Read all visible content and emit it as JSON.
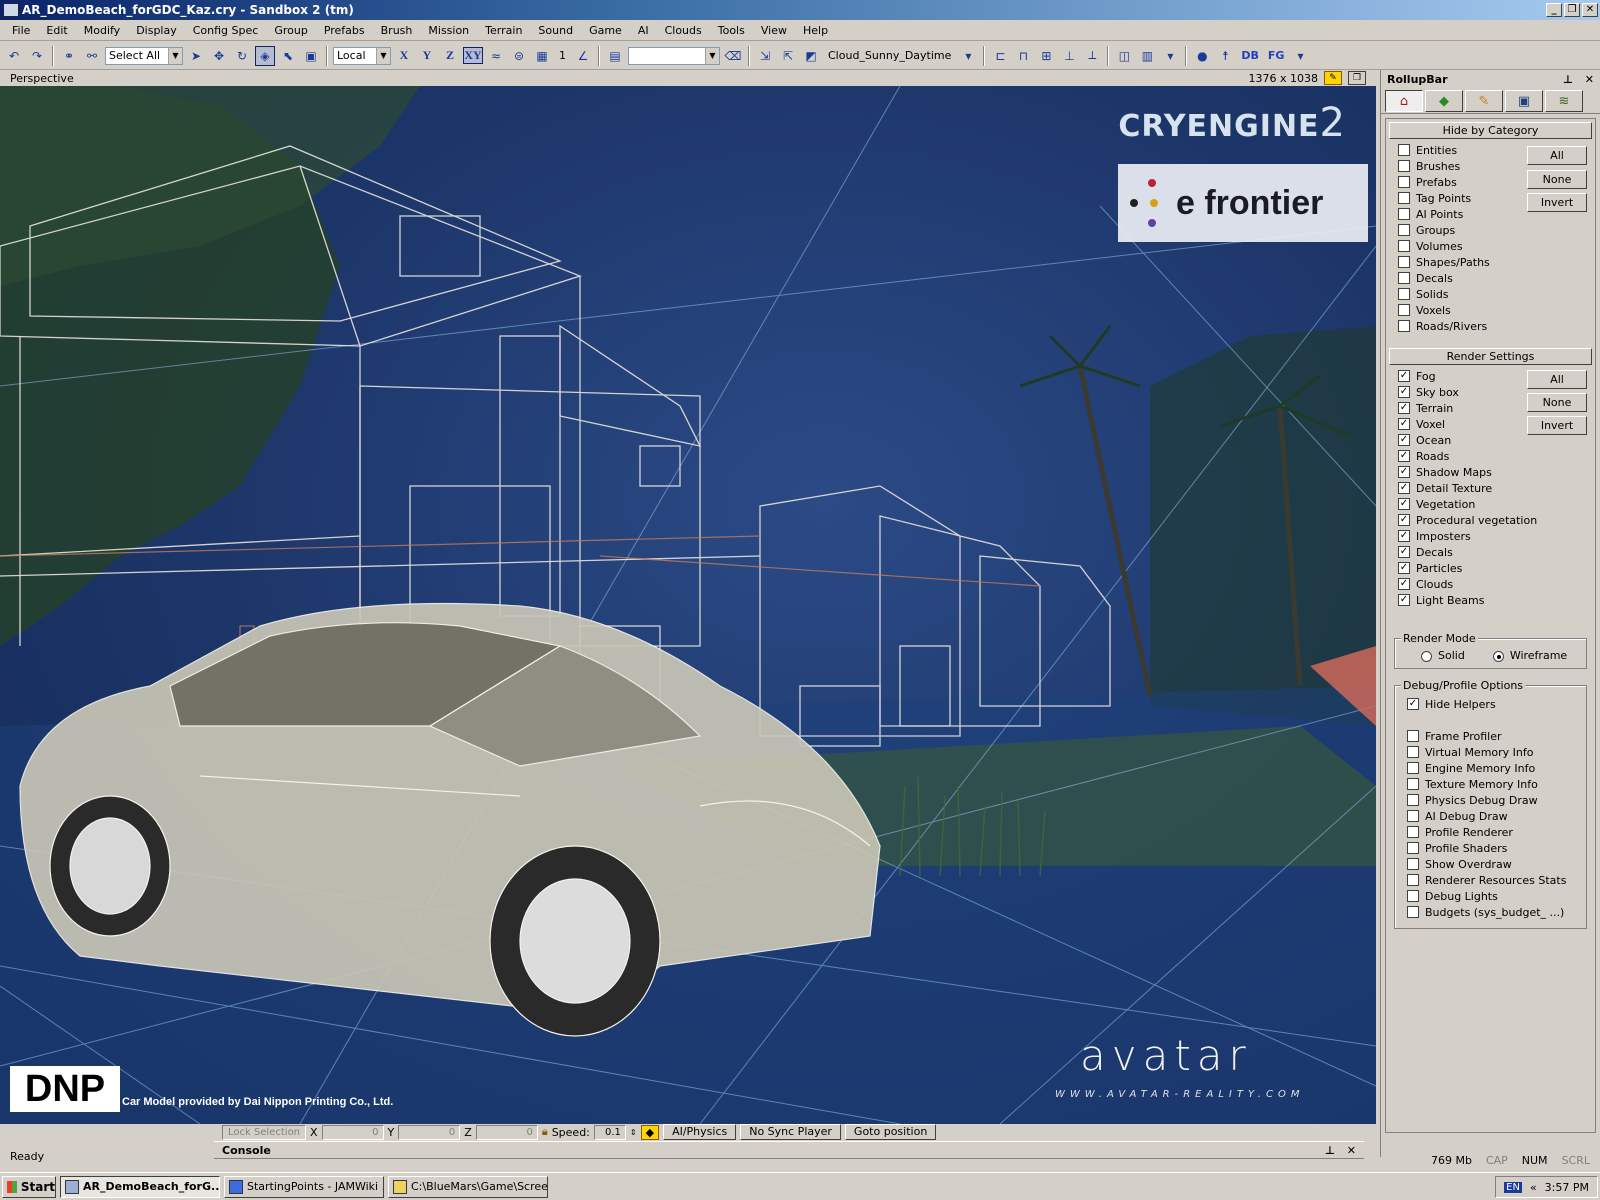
{
  "window": {
    "title": "AR_DemoBeach_forGDC_Kaz.cry - Sandbox 2 (tm)",
    "min_label": "_",
    "max_label": "❐",
    "close_label": "✕"
  },
  "menu": [
    "File",
    "Edit",
    "Modify",
    "Display",
    "Config Spec",
    "Group",
    "Prefabs",
    "Brush",
    "Mission",
    "Terrain",
    "Sound",
    "Game",
    "AI",
    "Clouds",
    "Tools",
    "View",
    "Help"
  ],
  "toolbar": {
    "select_value": "Select All",
    "coord_value": "Local",
    "axis_x": "X",
    "axis_y": "Y",
    "axis_z": "Z",
    "axis_xy": "XY",
    "grid_value": "1",
    "time_of_day": "Cloud_Sunny_Daytime",
    "db_label": "DB",
    "fg_label": "FG"
  },
  "viewport": {
    "name": "Perspective",
    "resolution": "1376 x 1038",
    "overlay_cryengine": "CRYENGINE",
    "overlay_cryengine_num": "2",
    "overlay_efrontier": "e frontier",
    "overlay_dnp": "DNP",
    "overlay_dnp_credit": "Car Model provided by Dai Nippon Printing Co., Ltd.",
    "overlay_avatar": "avatar",
    "overlay_avatar_url": "WWW.AVATAR-REALITY.COM"
  },
  "rollup": {
    "title": "RollupBar",
    "pin": "⊥",
    "close": "✕",
    "hide_by_category": {
      "title": "Hide by Category",
      "items": [
        "Entities",
        "Brushes",
        "Prefabs",
        "Tag Points",
        "AI Points",
        "Groups",
        "Volumes",
        "Shapes/Paths",
        "Decals",
        "Solids",
        "Voxels",
        "Roads/Rivers"
      ],
      "btn_all": "All",
      "btn_none": "None",
      "btn_invert": "Invert"
    },
    "render_settings": {
      "title": "Render Settings",
      "items": [
        "Fog",
        "Sky box",
        "Terrain",
        "Voxel",
        "Ocean",
        "Roads",
        "Shadow Maps",
        "Detail Texture",
        "Vegetation",
        "Procedural vegetation",
        "Imposters",
        "Decals",
        "Particles",
        "Clouds",
        "Light Beams"
      ],
      "btn_all": "All",
      "btn_none": "None",
      "btn_invert": "Invert"
    },
    "render_mode": {
      "title": "Render Mode",
      "solid": "Solid",
      "wireframe": "Wireframe",
      "selected": "Wireframe"
    },
    "debug": {
      "title": "Debug/Profile Options",
      "hide_helpers": "Hide Helpers",
      "items": [
        "Frame Profiler",
        "Virtual Memory Info",
        "Engine Memory Info",
        "Texture Memory Info",
        "Physics Debug Draw",
        "AI Debug Draw",
        "Profile Renderer",
        "Profile Shaders",
        "Show Overdraw",
        "Renderer Resources Stats",
        "Debug Lights",
        "Budgets (sys_budget_ ...)"
      ]
    }
  },
  "bottom": {
    "lock_selection": "Lock Selection",
    "x_label": "X",
    "x_value": "0",
    "y_label": "Y",
    "y_value": "0",
    "z_label": "Z",
    "z_value": "0",
    "speed_label": "Speed:",
    "speed_value": "0.1",
    "ai_physics": "AI/Physics",
    "no_sync": "No Sync Player",
    "goto": "Goto position",
    "console": "Console"
  },
  "status": {
    "ready": "Ready",
    "memory": "769 Mb",
    "cap": "CAP",
    "num": "NUM",
    "scrl": "SCRL"
  },
  "taskbar": {
    "start": "Start",
    "tasks": [
      "AR_DemoBeach_forG...",
      "StartingPoints - JAMWiki ...",
      "C:\\BlueMars\\Game\\Scree..."
    ],
    "lang": "EN",
    "time": "3:57 PM"
  }
}
